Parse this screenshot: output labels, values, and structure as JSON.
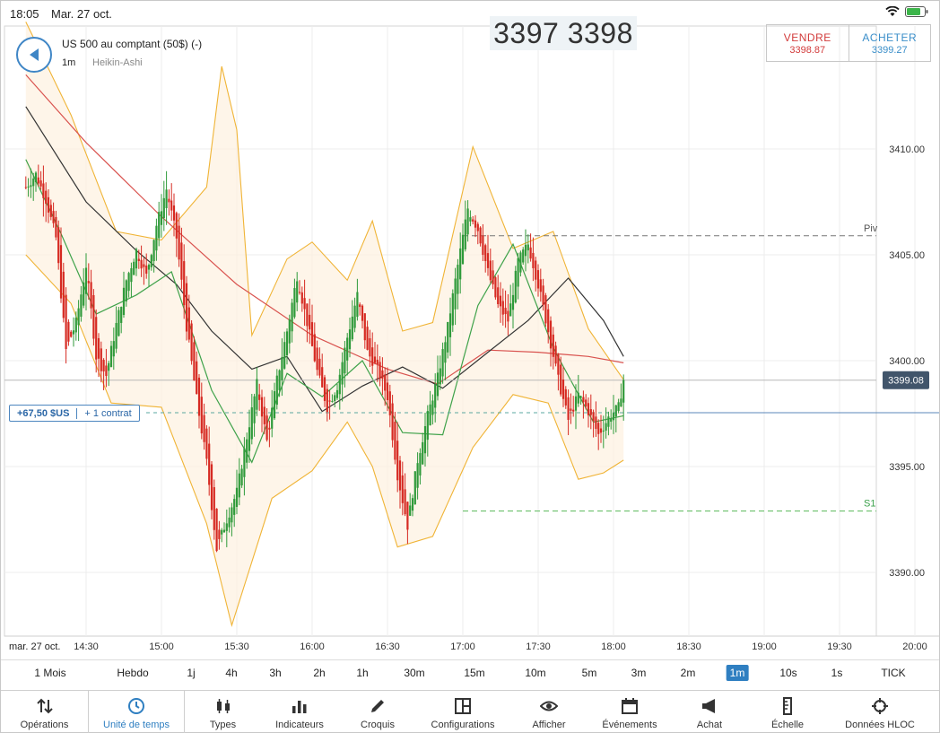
{
  "status": {
    "time": "18:05",
    "date": "Mar. 27 oct."
  },
  "header": {
    "instrument": "US 500 au comptant (50$) (-)",
    "timeframe": "1m",
    "chart_type": "Heikin-Ashi",
    "big_price": "3397 3398"
  },
  "trade": {
    "sell_label": "VENDRE",
    "sell_price": "3398.87",
    "buy_label": "ACHETER",
    "buy_price": "3399.27"
  },
  "position": {
    "pnl": "+67,50 $US",
    "contracts": "+ 1 contrat"
  },
  "colors": {
    "up": "#2f9a3a",
    "down": "#d62a22",
    "bollinger": "#f0b436",
    "ma_red": "#d9534f",
    "ma_black": "#333333",
    "ma_green": "#3fa24a",
    "accent": "#2f7fc1"
  },
  "chart_data": {
    "type": "candlestick",
    "candle_style": "Heikin-Ashi",
    "interval": "1m",
    "x_date_label": "mar. 27 oct.",
    "x_ticks": [
      "14:30",
      "15:00",
      "15:30",
      "16:00",
      "16:30",
      "17:00",
      "17:30",
      "18:00",
      "18:30",
      "19:00",
      "19:30",
      "20:00"
    ],
    "y_ticks": [
      "3410.00",
      "3405.00",
      "3400.00",
      "3395.00",
      "3390.00"
    ],
    "ylim": [
      3387,
      3416
    ],
    "last_price_label": "3399.08",
    "levels": [
      {
        "name": "Piv",
        "value": 3405.9
      },
      {
        "name": "S1",
        "value": 3392.9
      }
    ],
    "close_path": [
      [
        "14:06",
        3408.2
      ],
      [
        "14:10",
        3408.8
      ],
      [
        "14:14",
        3407.6
      ],
      [
        "14:18",
        3405.8
      ],
      [
        "14:22",
        3400.5
      ],
      [
        "14:26",
        3401.8
      ],
      [
        "14:30",
        3404.5
      ],
      [
        "14:34",
        3400.2
      ],
      [
        "14:38",
        3399.3
      ],
      [
        "14:42",
        3401.7
      ],
      [
        "14:46",
        3403.8
      ],
      [
        "14:50",
        3405.2
      ],
      [
        "14:54",
        3404.0
      ],
      [
        "14:58",
        3406.4
      ],
      [
        "15:02",
        3408.1
      ],
      [
        "15:06",
        3405.8
      ],
      [
        "15:10",
        3401.6
      ],
      [
        "15:14",
        3398.2
      ],
      [
        "15:18",
        3395.2
      ],
      [
        "15:22",
        3391.1
      ],
      [
        "15:26",
        3392.5
      ],
      [
        "15:30",
        3393.8
      ],
      [
        "15:34",
        3396.4
      ],
      [
        "15:38",
        3398.9
      ],
      [
        "15:42",
        3396.2
      ],
      [
        "15:46",
        3399.1
      ],
      [
        "15:50",
        3401.4
      ],
      [
        "15:54",
        3404.0
      ],
      [
        "15:58",
        3401.8
      ],
      [
        "16:02",
        3399.5
      ],
      [
        "16:06",
        3397.8
      ],
      [
        "16:10",
        3398.8
      ],
      [
        "16:14",
        3401.1
      ],
      [
        "16:18",
        3403.1
      ],
      [
        "16:22",
        3400.4
      ],
      [
        "16:26",
        3399.6
      ],
      [
        "16:30",
        3398.3
      ],
      [
        "16:34",
        3394.6
      ],
      [
        "16:38",
        3392.2
      ],
      [
        "16:42",
        3395.3
      ],
      [
        "16:46",
        3397.4
      ],
      [
        "16:50",
        3399.2
      ],
      [
        "16:54",
        3401.6
      ],
      [
        "16:58",
        3404.5
      ],
      [
        "17:02",
        3407.2
      ],
      [
        "17:06",
        3406.2
      ],
      [
        "17:10",
        3404.2
      ],
      [
        "17:14",
        3402.6
      ],
      [
        "17:18",
        3401.9
      ],
      [
        "17:22",
        3404.7
      ],
      [
        "17:26",
        3405.5
      ],
      [
        "17:30",
        3403.6
      ],
      [
        "17:34",
        3401.4
      ],
      [
        "17:38",
        3399.1
      ],
      [
        "17:42",
        3397.2
      ],
      [
        "17:46",
        3398.4
      ],
      [
        "17:50",
        3397.6
      ],
      [
        "17:54",
        3396.5
      ],
      [
        "17:58",
        3397.3
      ],
      [
        "18:02",
        3397.8
      ],
      [
        "18:04",
        3399.1
      ]
    ],
    "moving_averages": [
      {
        "color": "red",
        "points": [
          [
            "14:06",
            3413.5
          ],
          [
            "14:30",
            3410.3
          ],
          [
            "15:00",
            3406.8
          ],
          [
            "15:30",
            3403.6
          ],
          [
            "16:00",
            3401.2
          ],
          [
            "16:30",
            3399.6
          ],
          [
            "16:50",
            3398.9
          ],
          [
            "17:10",
            3400.5
          ],
          [
            "17:30",
            3400.4
          ],
          [
            "17:50",
            3400.2
          ],
          [
            "18:04",
            3399.9
          ]
        ]
      },
      {
        "color": "black",
        "points": [
          [
            "14:06",
            3412.0
          ],
          [
            "14:30",
            3407.5
          ],
          [
            "14:50",
            3405.2
          ],
          [
            "15:06",
            3403.6
          ],
          [
            "15:20",
            3401.4
          ],
          [
            "15:36",
            3399.6
          ],
          [
            "15:50",
            3400.2
          ],
          [
            "16:04",
            3397.6
          ],
          [
            "16:20",
            3398.8
          ],
          [
            "16:36",
            3399.7
          ],
          [
            "16:52",
            3398.7
          ],
          [
            "17:10",
            3400.4
          ],
          [
            "17:26",
            3401.9
          ],
          [
            "17:42",
            3403.9
          ],
          [
            "17:56",
            3401.9
          ],
          [
            "18:04",
            3400.2
          ]
        ]
      },
      {
        "color": "green",
        "points": [
          [
            "14:06",
            3409.5
          ],
          [
            "14:20",
            3406.0
          ],
          [
            "14:34",
            3402.2
          ],
          [
            "14:50",
            3403.1
          ],
          [
            "15:04",
            3404.2
          ],
          [
            "15:20",
            3398.6
          ],
          [
            "15:36",
            3395.2
          ],
          [
            "15:50",
            3399.4
          ],
          [
            "16:04",
            3398.3
          ],
          [
            "16:20",
            3400.0
          ],
          [
            "16:36",
            3396.6
          ],
          [
            "16:52",
            3396.5
          ],
          [
            "17:06",
            3402.6
          ],
          [
            "17:20",
            3405.5
          ],
          [
            "17:36",
            3400.6
          ],
          [
            "17:52",
            3397.1
          ],
          [
            "18:04",
            3397.4
          ]
        ]
      }
    ],
    "bollinger_upper": [
      [
        "14:06",
        3416.0
      ],
      [
        "14:24",
        3411.6
      ],
      [
        "14:42",
        3406.1
      ],
      [
        "15:00",
        3405.7
      ],
      [
        "15:18",
        3408.2
      ],
      [
        "15:24",
        3413.9
      ],
      [
        "15:30",
        3410.9
      ],
      [
        "15:36",
        3401.2
      ],
      [
        "15:50",
        3404.8
      ],
      [
        "16:00",
        3405.6
      ],
      [
        "16:14",
        3403.8
      ],
      [
        "16:24",
        3406.6
      ],
      [
        "16:36",
        3401.4
      ],
      [
        "16:48",
        3401.8
      ],
      [
        "17:04",
        3410.1
      ],
      [
        "17:20",
        3405.3
      ],
      [
        "17:36",
        3406.1
      ],
      [
        "17:50",
        3401.5
      ],
      [
        "18:04",
        3399.1
      ]
    ],
    "bollinger_lower": [
      [
        "14:06",
        3405.0
      ],
      [
        "14:24",
        3402.7
      ],
      [
        "14:40",
        3398.0
      ],
      [
        "15:00",
        3397.8
      ],
      [
        "15:18",
        3392.3
      ],
      [
        "15:28",
        3387.5
      ],
      [
        "15:44",
        3393.5
      ],
      [
        "16:00",
        3394.8
      ],
      [
        "16:14",
        3397.1
      ],
      [
        "16:24",
        3395.0
      ],
      [
        "16:34",
        3391.2
      ],
      [
        "16:48",
        3391.7
      ],
      [
        "17:04",
        3395.9
      ],
      [
        "17:20",
        3398.4
      ],
      [
        "17:34",
        3398.0
      ],
      [
        "17:46",
        3394.4
      ],
      [
        "17:56",
        3394.7
      ],
      [
        "18:04",
        3395.3
      ]
    ]
  },
  "timeframes": [
    "1 Mois",
    "Hebdo",
    "1j",
    "4h",
    "3h",
    "2h",
    "1h",
    "30m",
    "15m",
    "10m",
    "5m",
    "3m",
    "2m",
    "1m",
    "10s",
    "1s",
    "TICK"
  ],
  "active_timeframe": "1m",
  "toolbar": [
    {
      "label": "Opérations",
      "icon": "swap-arrows-icon"
    },
    {
      "label": "Unité de temps",
      "icon": "clock-icon"
    },
    {
      "label": "Types",
      "icon": "candles-icon"
    },
    {
      "label": "Indicateurs",
      "icon": "bar-chart-icon"
    },
    {
      "label": "Croquis",
      "icon": "pencil-icon"
    },
    {
      "label": "Configurations",
      "icon": "layout-grid-icon"
    },
    {
      "label": "Afficher",
      "icon": "eye-icon"
    },
    {
      "label": "Événements",
      "icon": "calendar-icon"
    },
    {
      "label": "Achat",
      "icon": "megaphone-icon"
    },
    {
      "label": "Échelle",
      "icon": "ruler-icon"
    },
    {
      "label": "Données HLOC",
      "icon": "crosshair-icon"
    }
  ],
  "active_tool": "Unité de temps"
}
